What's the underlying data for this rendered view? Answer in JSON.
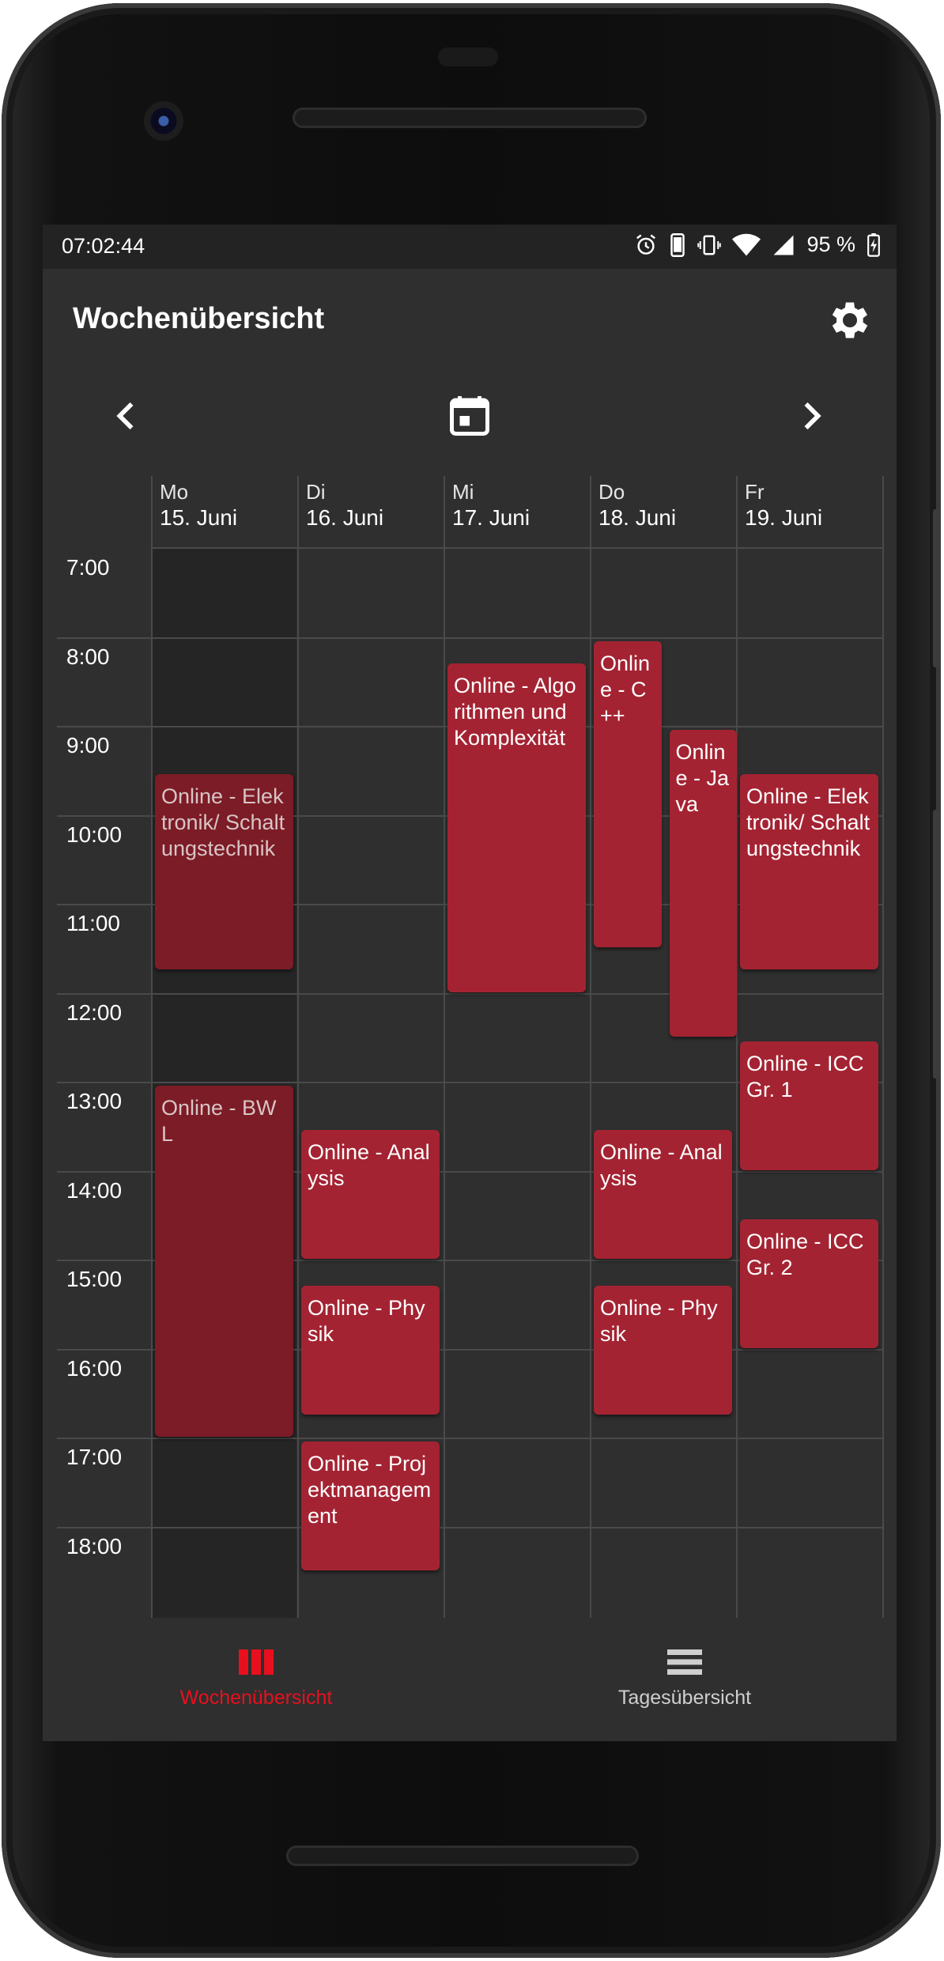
{
  "status_bar": {
    "time": "07:02:44",
    "battery": "95 %",
    "icons": [
      "alarm-icon",
      "phone-icon",
      "vibrate-icon",
      "wifi-icon",
      "signal-icon",
      "battery-charging-icon"
    ]
  },
  "app_bar": {
    "title": "Wochenübersicht",
    "settings_icon": "gear-icon"
  },
  "week_nav": {
    "prev_icon": "chevron-left-icon",
    "calendar_icon": "calendar-icon",
    "next_icon": "chevron-right-icon"
  },
  "days": [
    {
      "name": "Mo",
      "date": "15. Juni"
    },
    {
      "name": "Di",
      "date": "16. Juni"
    },
    {
      "name": "Mi",
      "date": "17. Juni"
    },
    {
      "name": "Do",
      "date": "18. Juni"
    },
    {
      "name": "Fr",
      "date": "19. Juni"
    }
  ],
  "hours": [
    "7:00",
    "8:00",
    "9:00",
    "10:00",
    "11:00",
    "12:00",
    "13:00",
    "14:00",
    "15:00",
    "16:00",
    "17:00",
    "18:00"
  ],
  "events": [
    {
      "day": 0,
      "start": "9:30",
      "end": "11:45",
      "title": "Online - Elektronik/ Schaltungstechnik",
      "past": true
    },
    {
      "day": 0,
      "start": "13:00",
      "end": "17:00",
      "title": "Online - BWL",
      "past": true
    },
    {
      "day": 1,
      "start": "13:30",
      "end": "15:00",
      "title": "Online - Analysis",
      "past": false
    },
    {
      "day": 1,
      "start": "15:15",
      "end": "16:45",
      "title": "Online - Physik",
      "past": false
    },
    {
      "day": 1,
      "start": "17:00",
      "end": "18:30",
      "title": "Online - Projektmanagement",
      "past": false
    },
    {
      "day": 2,
      "start": "8:15",
      "end": "12:00",
      "title": "Online - Algorithmen und Komplexität",
      "past": false
    },
    {
      "day": 3,
      "start": "8:00",
      "end": "11:30",
      "title": "Online - C++",
      "past": false
    },
    {
      "day": 3,
      "start": "9:00",
      "end": "12:30",
      "title": "Online - Java",
      "past": false
    },
    {
      "day": 3,
      "start": "13:30",
      "end": "15:00",
      "title": "Online - Analysis",
      "past": false
    },
    {
      "day": 3,
      "start": "15:15",
      "end": "16:45",
      "title": "Online - Physik",
      "past": false
    },
    {
      "day": 4,
      "start": "9:30",
      "end": "11:45",
      "title": "Online - Elektronik/ Schaltungstechnik",
      "past": false
    },
    {
      "day": 4,
      "start": "12:30",
      "end": "14:00",
      "title": "Online - ICC Gr. 1",
      "past": false
    },
    {
      "day": 4,
      "start": "14:30",
      "end": "16:00",
      "title": "Online - ICC Gr. 2",
      "past": false
    }
  ],
  "bottom_nav": [
    {
      "label": "Wochenübersicht",
      "icon": "week-view-icon",
      "active": true
    },
    {
      "label": "Tagesübersicht",
      "icon": "day-view-icon",
      "active": false
    }
  ],
  "colors": {
    "accent": "#e8101e",
    "event": "#a42332",
    "event_past": "#7c1c26",
    "background": "#2f2f2f"
  }
}
